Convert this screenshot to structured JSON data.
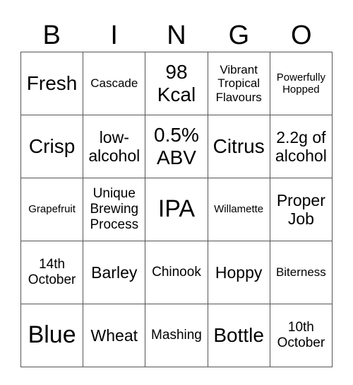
{
  "header": {
    "letters": [
      "B",
      "I",
      "N",
      "G",
      "O"
    ]
  },
  "board": {
    "rows": [
      [
        {
          "text": "Fresh",
          "size": "s-lg"
        },
        {
          "text": "Cascade",
          "size": "s-xs"
        },
        {
          "text": "98 Kcal",
          "size": "s-lg"
        },
        {
          "text": "Vibrant Tropical Flavours",
          "size": "s-xs"
        },
        {
          "text": "Powerfully Hopped",
          "size": "s-xxs"
        }
      ],
      [
        {
          "text": "Crisp",
          "size": "s-lg"
        },
        {
          "text": "low-alcohol",
          "size": "s-md"
        },
        {
          "text": "0.5% ABV",
          "size": "s-lg"
        },
        {
          "text": "Citrus",
          "size": "s-lg"
        },
        {
          "text": "2.2g of alcohol",
          "size": "s-md"
        }
      ],
      [
        {
          "text": "Grapefruit",
          "size": "s-xxs"
        },
        {
          "text": "Unique Brewing Process",
          "size": "s-sm"
        },
        {
          "text": "IPA",
          "size": "s-xl"
        },
        {
          "text": "Willamette",
          "size": "s-xxs"
        },
        {
          "text": "Proper Job",
          "size": "s-md"
        }
      ],
      [
        {
          "text": "14th October",
          "size": "s-sm"
        },
        {
          "text": "Barley",
          "size": "s-md"
        },
        {
          "text": "Chinook",
          "size": "s-sm"
        },
        {
          "text": "Hoppy",
          "size": "s-md"
        },
        {
          "text": "Biterness",
          "size": "s-xs"
        }
      ],
      [
        {
          "text": "Blue",
          "size": "s-xl"
        },
        {
          "text": "Wheat",
          "size": "s-md"
        },
        {
          "text": "Mashing",
          "size": "s-sm"
        },
        {
          "text": "Bottle",
          "size": "s-lg"
        },
        {
          "text": "10th October",
          "size": "s-sm"
        }
      ]
    ]
  }
}
